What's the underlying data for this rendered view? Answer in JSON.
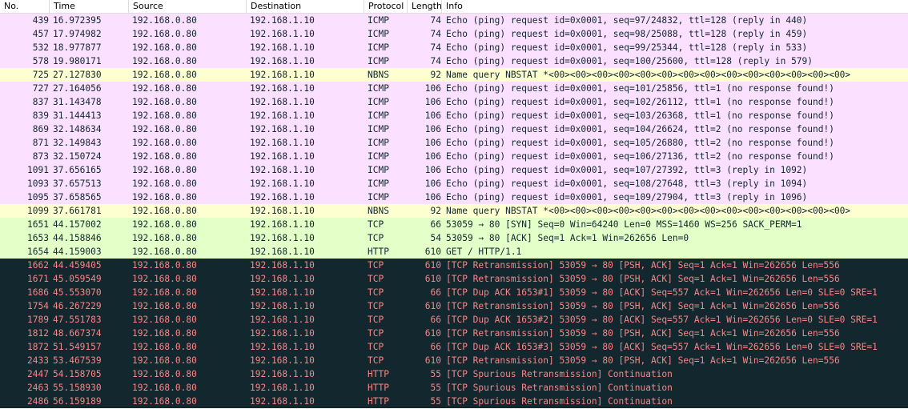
{
  "columns": {
    "no": "No.",
    "time": "Time",
    "source": "Source",
    "destination": "Destination",
    "protocol": "Protocol",
    "length": "Length",
    "info": "Info"
  },
  "colors": {
    "icmp_bg": "#fce0ff",
    "nbns_bg": "#feffd0",
    "tcp_bg": "#e7e6ff",
    "http_bg": "#e4ffc7",
    "bad_bg": "#12272e",
    "bad_fg": "#f78787",
    "normal_fg": "#12272e"
  },
  "rows": [
    {
      "no": "439",
      "time": "16.972395",
      "src": "192.168.0.80",
      "dst": "192.168.1.10",
      "proto": "ICMP",
      "len": "74",
      "info": "Echo (ping) request  id=0x0001, seq=97/24832, ttl=128 (reply in 440)",
      "style": "icmp"
    },
    {
      "no": "457",
      "time": "17.974982",
      "src": "192.168.0.80",
      "dst": "192.168.1.10",
      "proto": "ICMP",
      "len": "74",
      "info": "Echo (ping) request  id=0x0001, seq=98/25088, ttl=128 (reply in 459)",
      "style": "icmp"
    },
    {
      "no": "532",
      "time": "18.977877",
      "src": "192.168.0.80",
      "dst": "192.168.1.10",
      "proto": "ICMP",
      "len": "74",
      "info": "Echo (ping) request  id=0x0001, seq=99/25344, ttl=128 (reply in 533)",
      "style": "icmp"
    },
    {
      "no": "578",
      "time": "19.980171",
      "src": "192.168.0.80",
      "dst": "192.168.1.10",
      "proto": "ICMP",
      "len": "74",
      "info": "Echo (ping) request  id=0x0001, seq=100/25600, ttl=128 (reply in 579)",
      "style": "icmp"
    },
    {
      "no": "725",
      "time": "27.127830",
      "src": "192.168.0.80",
      "dst": "192.168.1.10",
      "proto": "NBNS",
      "len": "92",
      "info": "Name query NBSTAT *<00><00><00><00><00><00><00><00><00><00><00><00><00><00>",
      "style": "nbns"
    },
    {
      "no": "727",
      "time": "27.164056",
      "src": "192.168.0.80",
      "dst": "192.168.1.10",
      "proto": "ICMP",
      "len": "106",
      "info": "Echo (ping) request  id=0x0001, seq=101/25856, ttl=1 (no response found!)",
      "style": "icmp"
    },
    {
      "no": "837",
      "time": "31.143478",
      "src": "192.168.0.80",
      "dst": "192.168.1.10",
      "proto": "ICMP",
      "len": "106",
      "info": "Echo (ping) request  id=0x0001, seq=102/26112, ttl=1 (no response found!)",
      "style": "icmp"
    },
    {
      "no": "839",
      "time": "31.144413",
      "src": "192.168.0.80",
      "dst": "192.168.1.10",
      "proto": "ICMP",
      "len": "106",
      "info": "Echo (ping) request  id=0x0001, seq=103/26368, ttl=1 (no response found!)",
      "style": "icmp"
    },
    {
      "no": "869",
      "time": "32.148634",
      "src": "192.168.0.80",
      "dst": "192.168.1.10",
      "proto": "ICMP",
      "len": "106",
      "info": "Echo (ping) request  id=0x0001, seq=104/26624, ttl=2 (no response found!)",
      "style": "icmp"
    },
    {
      "no": "871",
      "time": "32.149843",
      "src": "192.168.0.80",
      "dst": "192.168.1.10",
      "proto": "ICMP",
      "len": "106",
      "info": "Echo (ping) request  id=0x0001, seq=105/26880, ttl=2 (no response found!)",
      "style": "icmp"
    },
    {
      "no": "873",
      "time": "32.150724",
      "src": "192.168.0.80",
      "dst": "192.168.1.10",
      "proto": "ICMP",
      "len": "106",
      "info": "Echo (ping) request  id=0x0001, seq=106/27136, ttl=2 (no response found!)",
      "style": "icmp"
    },
    {
      "no": "1091",
      "time": "37.656165",
      "src": "192.168.0.80",
      "dst": "192.168.1.10",
      "proto": "ICMP",
      "len": "106",
      "info": "Echo (ping) request  id=0x0001, seq=107/27392, ttl=3 (reply in 1092)",
      "style": "icmp"
    },
    {
      "no": "1093",
      "time": "37.657513",
      "src": "192.168.0.80",
      "dst": "192.168.1.10",
      "proto": "ICMP",
      "len": "106",
      "info": "Echo (ping) request  id=0x0001, seq=108/27648, ttl=3 (reply in 1094)",
      "style": "icmp"
    },
    {
      "no": "1095",
      "time": "37.658565",
      "src": "192.168.0.80",
      "dst": "192.168.1.10",
      "proto": "ICMP",
      "len": "106",
      "info": "Echo (ping) request  id=0x0001, seq=109/27904, ttl=3 (reply in 1096)",
      "style": "icmp"
    },
    {
      "no": "1099",
      "time": "37.661781",
      "src": "192.168.0.80",
      "dst": "192.168.1.10",
      "proto": "NBNS",
      "len": "92",
      "info": "Name query NBSTAT *<00><00><00><00><00><00><00><00><00><00><00><00><00><00>",
      "style": "nbns"
    },
    {
      "no": "1651",
      "time": "44.157002",
      "src": "192.168.0.80",
      "dst": "192.168.1.10",
      "proto": "TCP",
      "len": "66",
      "info": "53059 → 80 [SYN] Seq=0 Win=64240 Len=0 MSS=1460 WS=256 SACK_PERM=1",
      "style": "http"
    },
    {
      "no": "1653",
      "time": "44.158846",
      "src": "192.168.0.80",
      "dst": "192.168.1.10",
      "proto": "TCP",
      "len": "54",
      "info": "53059 → 80 [ACK] Seq=1 Ack=1 Win=262656 Len=0",
      "style": "http"
    },
    {
      "no": "1654",
      "time": "44.159003",
      "src": "192.168.0.80",
      "dst": "192.168.1.10",
      "proto": "HTTP",
      "len": "610",
      "info": "GET / HTTP/1.1",
      "style": "http"
    },
    {
      "no": "1662",
      "time": "44.459405",
      "src": "192.168.0.80",
      "dst": "192.168.1.10",
      "proto": "TCP",
      "len": "610",
      "info": "[TCP Retransmission] 53059 → 80 [PSH, ACK] Seq=1 Ack=1 Win=262656 Len=556",
      "style": "bad"
    },
    {
      "no": "1671",
      "time": "45.059549",
      "src": "192.168.0.80",
      "dst": "192.168.1.10",
      "proto": "TCP",
      "len": "610",
      "info": "[TCP Retransmission] 53059 → 80 [PSH, ACK] Seq=1 Ack=1 Win=262656 Len=556",
      "style": "bad"
    },
    {
      "no": "1686",
      "time": "45.553070",
      "src": "192.168.0.80",
      "dst": "192.168.1.10",
      "proto": "TCP",
      "len": "66",
      "info": "[TCP Dup ACK 1653#1] 53059 → 80 [ACK] Seq=557 Ack=1 Win=262656 Len=0 SLE=0 SRE=1",
      "style": "bad"
    },
    {
      "no": "1754",
      "time": "46.267229",
      "src": "192.168.0.80",
      "dst": "192.168.1.10",
      "proto": "TCP",
      "len": "610",
      "info": "[TCP Retransmission] 53059 → 80 [PSH, ACK] Seq=1 Ack=1 Win=262656 Len=556",
      "style": "bad"
    },
    {
      "no": "1789",
      "time": "47.551783",
      "src": "192.168.0.80",
      "dst": "192.168.1.10",
      "proto": "TCP",
      "len": "66",
      "info": "[TCP Dup ACK 1653#2] 53059 → 80 [ACK] Seq=557 Ack=1 Win=262656 Len=0 SLE=0 SRE=1",
      "style": "bad"
    },
    {
      "no": "1812",
      "time": "48.667374",
      "src": "192.168.0.80",
      "dst": "192.168.1.10",
      "proto": "TCP",
      "len": "610",
      "info": "[TCP Retransmission] 53059 → 80 [PSH, ACK] Seq=1 Ack=1 Win=262656 Len=556",
      "style": "bad"
    },
    {
      "no": "1872",
      "time": "51.549157",
      "src": "192.168.0.80",
      "dst": "192.168.1.10",
      "proto": "TCP",
      "len": "66",
      "info": "[TCP Dup ACK 1653#3] 53059 → 80 [ACK] Seq=557 Ack=1 Win=262656 Len=0 SLE=0 SRE=1",
      "style": "bad"
    },
    {
      "no": "2433",
      "time": "53.467539",
      "src": "192.168.0.80",
      "dst": "192.168.1.10",
      "proto": "TCP",
      "len": "610",
      "info": "[TCP Retransmission] 53059 → 80 [PSH, ACK] Seq=1 Ack=1 Win=262656 Len=556",
      "style": "bad"
    },
    {
      "no": "2447",
      "time": "54.158705",
      "src": "192.168.0.80",
      "dst": "192.168.1.10",
      "proto": "HTTP",
      "len": "55",
      "info": "[TCP Spurious Retransmission] Continuation",
      "style": "bad"
    },
    {
      "no": "2463",
      "time": "55.158930",
      "src": "192.168.0.80",
      "dst": "192.168.1.10",
      "proto": "HTTP",
      "len": "55",
      "info": "[TCP Spurious Retransmission] Continuation",
      "style": "bad"
    },
    {
      "no": "2486",
      "time": "56.159189",
      "src": "192.168.0.80",
      "dst": "192.168.1.10",
      "proto": "HTTP",
      "len": "55",
      "info": "[TCP Spurious Retransmission] Continuation",
      "style": "bad"
    }
  ]
}
